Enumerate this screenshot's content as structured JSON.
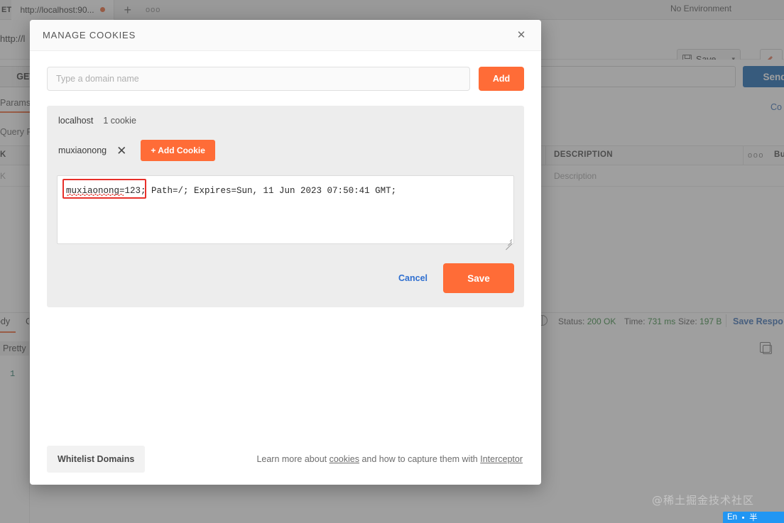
{
  "background": {
    "tab": {
      "method": "ET",
      "label": "http://localhost:90...",
      "unsaved_dot": "unsaved-dot",
      "new_tab": "+",
      "more": "ooo"
    },
    "environment": "No Environment",
    "url_text": "http://l",
    "save_button": "Save",
    "method": "GET",
    "send_button": "Send",
    "tabs": {
      "params": "Params",
      "query_params": "Query P",
      "cookies_link": "Co"
    },
    "table": {
      "headers": {
        "key": "K",
        "description": "DESCRIPTION",
        "bulk": "Bu",
        "more": "ooo"
      },
      "rows": [
        {
          "key": "K",
          "description": "Description"
        }
      ]
    },
    "response": {
      "tab_body": "ody",
      "tab_cookies": "C",
      "status_label": "Status:",
      "status_value": "200 OK",
      "time_label": "Time:",
      "time_value": "731 ms",
      "size_label": "Size:",
      "size_value": "197 B",
      "save_response": "Save Respo",
      "pretty": "Pretty",
      "line_number": "1"
    }
  },
  "modal": {
    "title": "MANAGE COOKIES",
    "close_label": "✕",
    "domain_input": {
      "value": "",
      "placeholder": "Type a domain name"
    },
    "add_button": "Add",
    "domain_card": {
      "name": "localhost",
      "count": "1 cookie"
    },
    "cookie_chip": {
      "name": "muxiaonong",
      "remove_label": "✕"
    },
    "add_cookie_button": "+ Add Cookie",
    "cookie_value": "muxiaonong=123; Path=/; Expires=Sun, 11 Jun 2023 07:50:41 GMT;",
    "cancel_button": "Cancel",
    "save_button": "Save",
    "whitelist_button": "Whitelist Domains",
    "footer_note": {
      "prefix": "Learn more about ",
      "link_cookies": "cookies",
      "middle": " and how to capture them with ",
      "link_interceptor": "Interceptor"
    }
  },
  "watermark": "@稀土掘金技术社区",
  "ime": {
    "lang": "En",
    "shape": "·",
    "width": "半"
  },
  "colors": {
    "accent_orange": "#ff6c37",
    "link_blue": "#2f6fd0",
    "send_blue": "#1a69b4",
    "highlight_red": "#e8302a",
    "status_green": "#3a8a43"
  }
}
